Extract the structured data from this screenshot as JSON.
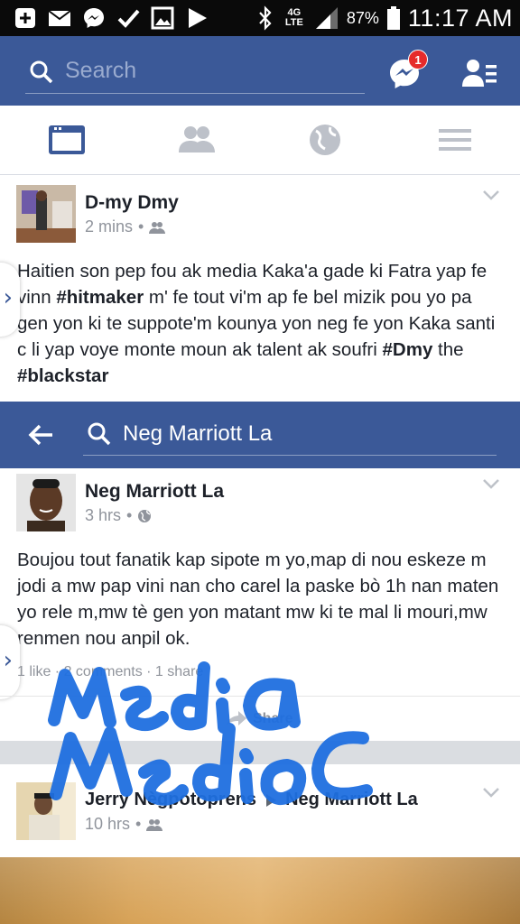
{
  "status_bar": {
    "battery": "87%",
    "time": "11:17 AM",
    "network": "4G LTE"
  },
  "header": {
    "search_placeholder": "Search",
    "messenger_badge": "1"
  },
  "posts": [
    {
      "author": "D-my Dmy",
      "time": "2 mins",
      "audience": "friends-icon",
      "text_parts": [
        "Haitien son pep fou ak media Kaka'a gade ki Fatra yap fe vinn ",
        "#hitmaker",
        " m' fe tout vi'm ap fe bel mizik pou yo pa gen yon ki te suppote'm kounya yon neg fe yon Kaka santi c li yap voye monte moun ak talent ak soufri ",
        "#Dmy",
        " the ",
        "#blackstar"
      ]
    },
    {
      "author": "Neg Marriott La",
      "time": "3 hrs",
      "audience": "globe-icon",
      "text": "Boujou tout fanatik kap sipote m yo,map di nou eskeze m jodi a mw pap vini nan cho carel la paske bò 1h nan maten yo rele m,mw tè gen yon matant mw ki te mal li mouri,mw renmen nou anpil ok.",
      "actions": "1 like · 2 comments · 1 share",
      "share_label": "Share"
    },
    {
      "author": "Jerry Nègpotoprens",
      "target": "Neg Marriott La",
      "time": "10 hrs",
      "audience": "friends-icon"
    }
  ],
  "inner_search": {
    "query": "Neg Marriott La"
  },
  "annotation": {
    "text": "Media Medioc",
    "color": "#1f6fe0"
  }
}
